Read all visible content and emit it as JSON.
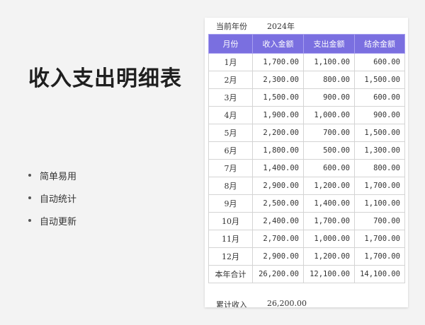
{
  "page": {
    "title": "收入支出明细表",
    "features": [
      "简单易用",
      "自动统计",
      "自动更新"
    ]
  },
  "sheet": {
    "year_label": "当前年份",
    "year_value": "2024年",
    "headers": [
      "月份",
      "收入金额",
      "支出金额",
      "结余金额"
    ],
    "rows": [
      [
        "1月",
        "1,700.00",
        "1,100.00",
        "600.00"
      ],
      [
        "2月",
        "2,300.00",
        "800.00",
        "1,500.00"
      ],
      [
        "3月",
        "1,500.00",
        "900.00",
        "600.00"
      ],
      [
        "4月",
        "1,900.00",
        "1,000.00",
        "900.00"
      ],
      [
        "5月",
        "2,200.00",
        "700.00",
        "1,500.00"
      ],
      [
        "6月",
        "1,800.00",
        "500.00",
        "1,300.00"
      ],
      [
        "7月",
        "1,400.00",
        "600.00",
        "800.00"
      ],
      [
        "8月",
        "2,900.00",
        "1,200.00",
        "1,700.00"
      ],
      [
        "9月",
        "2,500.00",
        "1,400.00",
        "1,100.00"
      ],
      [
        "10月",
        "2,400.00",
        "1,700.00",
        "700.00"
      ],
      [
        "11月",
        "2,700.00",
        "1,000.00",
        "1,700.00"
      ],
      [
        "12月",
        "2,900.00",
        "1,200.00",
        "1,700.00"
      ],
      [
        "本年合计",
        "26,200.00",
        "12,100.00",
        "14,100.00"
      ]
    ],
    "cumulative_label": "累计收入",
    "cumulative_value": "26,200.00"
  }
}
